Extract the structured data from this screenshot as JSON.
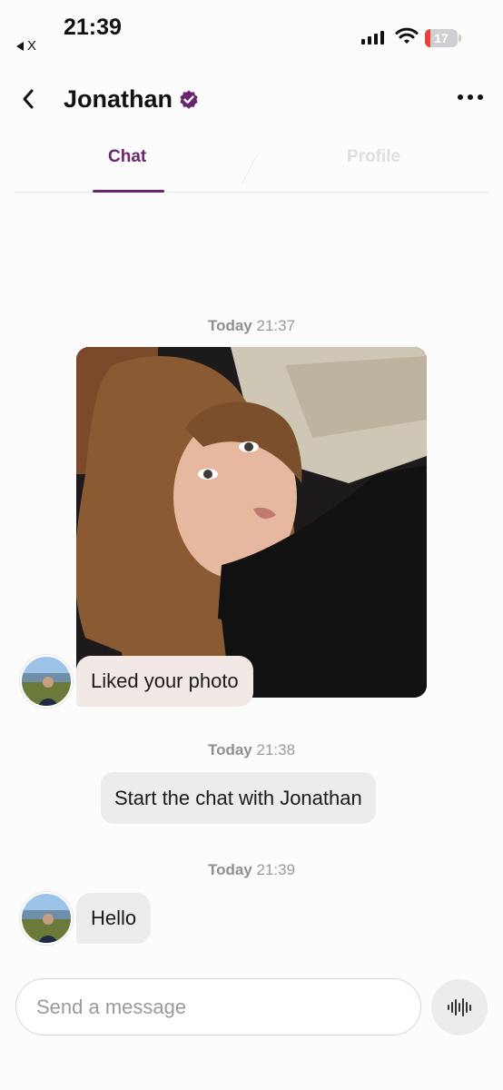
{
  "status_bar": {
    "time": "21:39",
    "back_app": "X",
    "battery": "17"
  },
  "header": {
    "title": "Jonathan"
  },
  "tabs": [
    {
      "label": "Chat",
      "active": true
    },
    {
      "label": "Profile",
      "active": false
    }
  ],
  "messages": {
    "ts1": {
      "day": "Today",
      "time": "21:37"
    },
    "liked_text": "Liked your photo",
    "ts2": {
      "day": "Today",
      "time": "21:38"
    },
    "system_text": "Start the chat with Jonathan",
    "ts3": {
      "day": "Today",
      "time": "21:39"
    },
    "hello_text": "Hello"
  },
  "composer": {
    "placeholder": "Send a message"
  },
  "colors": {
    "accent": "#6a2470",
    "liked_bubble": "#f2e9e6",
    "neutral_bubble": "#ececec",
    "battery_low": "#e8403a"
  },
  "icons": [
    "back-chevron-icon",
    "verified-badge-icon",
    "more-dots-icon",
    "voice-waveform-icon",
    "wifi-icon",
    "signal-icon",
    "battery-icon"
  ]
}
